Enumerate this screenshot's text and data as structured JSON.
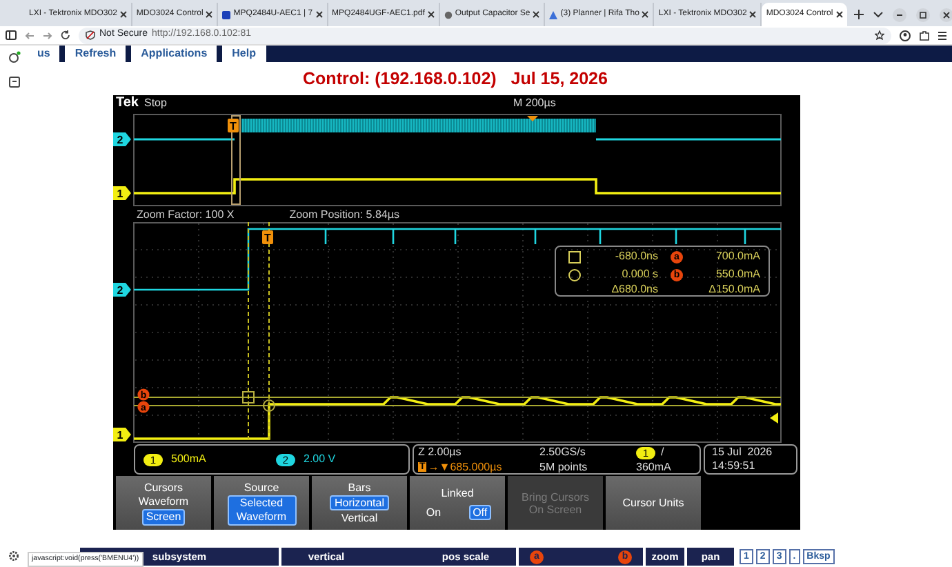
{
  "browser": {
    "tabs": [
      {
        "label": "LXI - Tektronix MDO302",
        "selected": false
      },
      {
        "label": "MDO3024 Control",
        "selected": false
      },
      {
        "label": "MPQ2484U-AEC1 | 7",
        "selected": false
      },
      {
        "label": "MPQ2484UGF-AEC1.pdf",
        "selected": false
      },
      {
        "label": "Output Capacitor Se",
        "selected": false
      },
      {
        "label": "(3) Planner | Rifa Tho",
        "selected": false
      },
      {
        "label": "LXI - Tektronix MDO302",
        "selected": false
      },
      {
        "label": "MDO3024 Control",
        "selected": true
      }
    ],
    "security": "Not Secure",
    "url": "http://192.168.0.102:81"
  },
  "nav": [
    "us",
    "Refresh",
    "Applications",
    "Help"
  ],
  "title": "Control: (192.168.0.102)   Jul 15, 2026",
  "scope": {
    "brand": "Tek",
    "run_state": "Stop",
    "timebase": "M 200µs",
    "top_trigger": "T",
    "lower_trigger": "T",
    "top_markers": [
      {
        "label": "2",
        "color": "#1fd6e0"
      },
      {
        "label": "1",
        "color": "#f2ee12"
      }
    ],
    "zoom_factor": "Zoom Factor: 100 X",
    "zoom_position": "Zoom Position: 5.84µs",
    "lower_markers": [
      {
        "label": "2",
        "color": "#1fd6e0"
      },
      {
        "label": "1",
        "color": "#f2ee12"
      }
    ],
    "cursor_labels": [
      "b",
      "a"
    ],
    "readout": [
      {
        "kind": "square",
        "time": "-680.0ns",
        "cursor": "a",
        "value": "700.0mA"
      },
      {
        "kind": "circle",
        "time": "0.000 s",
        "cursor": "b",
        "value": "550.0mA"
      },
      {
        "kind": "delta",
        "time": "Δ680.0ns",
        "value": "Δ150.0mA"
      }
    ],
    "channels": [
      {
        "label": "1",
        "scale": "500mA",
        "color": "#f2ee12"
      },
      {
        "label": "2",
        "scale": "2.00 V",
        "color": "#1fd6e0"
      }
    ],
    "acquisition": {
      "trigger_label": "T",
      "zoom_scale": "Z 2.00µs",
      "trigger_position": "→▼685.000µs",
      "sample_rate": "2.50GS/s",
      "record_length": "5M points",
      "trigger_source": "1",
      "trigger_slope": "/",
      "trigger_level": "360mA"
    },
    "date": "15 Jul  2026",
    "time": "14:59:51",
    "menu": [
      {
        "title": "Cursors",
        "kind": "stack",
        "disabled": false,
        "options": [
          {
            "label": "Waveform",
            "selected": false
          },
          {
            "label": "Screen",
            "selected": true
          }
        ]
      },
      {
        "title": "Source",
        "kind": "stack",
        "disabled": false,
        "options": [
          {
            "label": "Selected Waveform",
            "selected": true
          }
        ]
      },
      {
        "title": "Bars",
        "kind": "stack",
        "disabled": false,
        "options": [
          {
            "label": "Horizontal",
            "selected": true
          },
          {
            "label": "Vertical",
            "selected": false
          }
        ]
      },
      {
        "title": "Linked",
        "kind": "row",
        "disabled": false,
        "options": [
          {
            "label": "On",
            "selected": false
          },
          {
            "label": "Off",
            "selected": true
          }
        ]
      },
      {
        "title": "Bring Cursors On Screen",
        "kind": "plain",
        "disabled": true
      },
      {
        "title": "Cursor Units",
        "kind": "plain",
        "disabled": false
      }
    ]
  },
  "bottom_bar": [
    {
      "kind": "cell",
      "texts": [
        "subsystem"
      ]
    },
    {
      "kind": "cell",
      "texts": [
        "vertical",
        "pos scale"
      ]
    },
    {
      "kind": "cursors",
      "texts": [
        "a",
        "b"
      ]
    },
    {
      "kind": "cell",
      "texts": [
        "zoom"
      ]
    },
    {
      "kind": "cell",
      "texts": [
        "pan"
      ]
    },
    {
      "kind": "keys",
      "texts": [
        "1",
        "2",
        "3",
        ".",
        "Bksp"
      ]
    }
  ],
  "status_url": "javascript:void(press('BMENU4'))"
}
